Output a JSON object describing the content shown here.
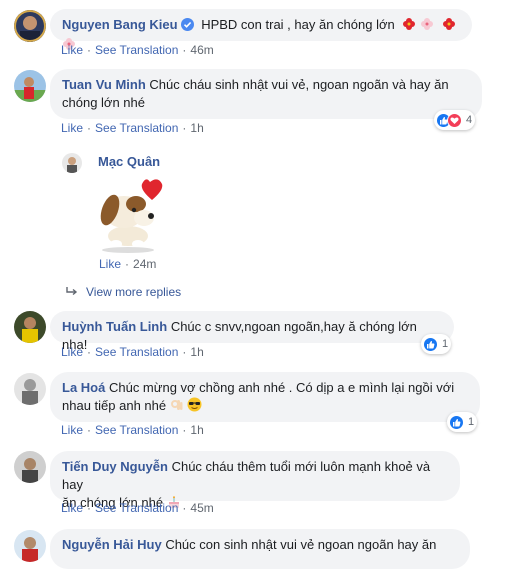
{
  "comments": [
    {
      "name": "Nguyen Bang Kieu",
      "text": "HPBD con trai , hay ăn chóng lớn",
      "like": "Like",
      "translate": "See Translation",
      "time": "46m"
    },
    {
      "name": "Tuan Vu Minh",
      "text": "Chúc cháu sinh nhật vui vẻ, ngoan ngoãn và hay ăn",
      "text2": "chóng lớn nhé",
      "like": "Like",
      "translate": "See Translation",
      "time": "1h",
      "reactions": "4"
    },
    {
      "name": "Mạc Quân",
      "like": "Like",
      "time": "24m"
    },
    {
      "name": "Huỳnh Tuấn Linh",
      "text": "Chúc c snvv,ngoan ngoãn,hay ă chóng lớn nha!",
      "like": "Like",
      "translate": "See Translation",
      "time": "1h",
      "reactions": "1"
    },
    {
      "name": "La Hoá",
      "text": "Chúc mừng vợ chồng anh nhé . Có dịp a e mình lại ngồi với",
      "text2": "nhau tiếp anh nhé",
      "like": "Like",
      "translate": "See Translation",
      "time": "1h",
      "reactions": "1"
    },
    {
      "name": "Tiến Duy Nguyễn",
      "text": "Chúc cháu thêm tuổi mới luôn mạnh khoẻ và hay",
      "text2": "ăn chóng lớn nhé",
      "like": "Like",
      "translate": "See Translation",
      "time": "45m"
    },
    {
      "name": "Nguyễn Hải Huy",
      "text": "Chúc con sinh nhật vui vẻ ngoan ngoãn hay ăn"
    }
  ],
  "view_more": "View more replies",
  "colors": {
    "name": "#385898",
    "link": "#4267b2",
    "bubble": "#f2f3f5",
    "meta": "#606770"
  },
  "icons": [
    "verified-badge-icon",
    "flower-emoji",
    "like-reaction-icon",
    "love-reaction-icon",
    "reply-arrow-icon",
    "ok-hand-emoji",
    "sunglasses-emoji",
    "cake-emoji",
    "dog-heart-sticker"
  ]
}
